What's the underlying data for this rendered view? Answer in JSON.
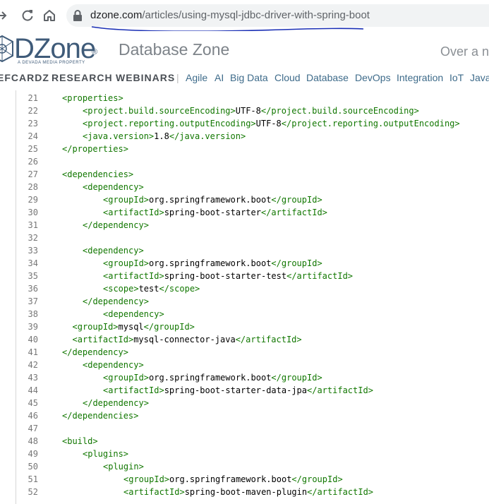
{
  "browser": {
    "url_domain": "dzone.com",
    "url_path": "/articles/using-mysql-jdbc-driver-with-spring-boot"
  },
  "site": {
    "logo_text": "DZone",
    "logo_tagline": "A DEVADA MEDIA PROPERTY",
    "zone_title": "Database Zone",
    "header_right_text": "Over a n"
  },
  "nav": {
    "bold_items": [
      "EFCARDZ",
      "RESEARCH",
      "WEBINARS"
    ],
    "separator": "|",
    "links": [
      "Agile",
      "AI",
      "Big Data",
      "Cloud",
      "Database",
      "DevOps",
      "Integration",
      "IoT",
      "Java"
    ]
  },
  "code": {
    "lines": [
      {
        "n": "21",
        "indent": 1,
        "text": "<properties>"
      },
      {
        "n": "22",
        "indent": 2,
        "text": "<project.build.sourceEncoding>UTF-8</project.build.sourceEncoding>"
      },
      {
        "n": "23",
        "indent": 2,
        "text": "<project.reporting.outputEncoding>UTF-8</project.reporting.outputEncoding>"
      },
      {
        "n": "24",
        "indent": 2,
        "text": "<java.version>1.8</java.version>"
      },
      {
        "n": "25",
        "indent": 1,
        "text": "</properties>"
      },
      {
        "n": "26",
        "indent": 0,
        "text": ""
      },
      {
        "n": "27",
        "indent": 1,
        "text": "<dependencies>"
      },
      {
        "n": "28",
        "indent": 2,
        "text": "<dependency>"
      },
      {
        "n": "29",
        "indent": 3,
        "text": "<groupId>org.springframework.boot</groupId>"
      },
      {
        "n": "30",
        "indent": 3,
        "text": "<artifactId>spring-boot-starter</artifactId>"
      },
      {
        "n": "31",
        "indent": 2,
        "text": "</dependency>"
      },
      {
        "n": "32",
        "indent": 0,
        "text": ""
      },
      {
        "n": "33",
        "indent": 2,
        "text": "<dependency>"
      },
      {
        "n": "34",
        "indent": 3,
        "text": "<groupId>org.springframework.boot</groupId>"
      },
      {
        "n": "35",
        "indent": 3,
        "text": "<artifactId>spring-boot-starter-test</artifactId>"
      },
      {
        "n": "36",
        "indent": 3,
        "text": "<scope>test</scope>"
      },
      {
        "n": "37",
        "indent": 2,
        "text": "</dependency>"
      },
      {
        "n": "38",
        "indent": 3,
        "text": "<dependency>"
      },
      {
        "n": "39",
        "indent": 1.5,
        "text": "<groupId>mysql</groupId>"
      },
      {
        "n": "40",
        "indent": 1.5,
        "text": "<artifactId>mysql-connector-java</artifactId>"
      },
      {
        "n": "41",
        "indent": 1,
        "text": "</dependency>"
      },
      {
        "n": "42",
        "indent": 2,
        "text": "<dependency>"
      },
      {
        "n": "43",
        "indent": 3,
        "text": "<groupId>org.springframework.boot</groupId>"
      },
      {
        "n": "44",
        "indent": 3,
        "text": "<artifactId>spring-boot-starter-data-jpa</artifactId>"
      },
      {
        "n": "45",
        "indent": 2,
        "text": "</dependency>"
      },
      {
        "n": "46",
        "indent": 1,
        "text": "</dependencies>"
      },
      {
        "n": "47",
        "indent": 0,
        "text": ""
      },
      {
        "n": "48",
        "indent": 1,
        "text": "<build>"
      },
      {
        "n": "49",
        "indent": 2,
        "text": "<plugins>"
      },
      {
        "n": "50",
        "indent": 3,
        "text": "<plugin>"
      },
      {
        "n": "51",
        "indent": 4,
        "text": "<groupId>org.springframework.boot</groupId>"
      },
      {
        "n": "52",
        "indent": 4,
        "text": "<artifactId>spring-boot-maven-plugin</artifactId>"
      }
    ]
  },
  "colors": {
    "tag": "#117700",
    "text": "#000000",
    "line_number": "#777777",
    "logo": "#3f5b79",
    "nav_link": "#3e6b8a",
    "scribble": "#1a2fb5"
  }
}
